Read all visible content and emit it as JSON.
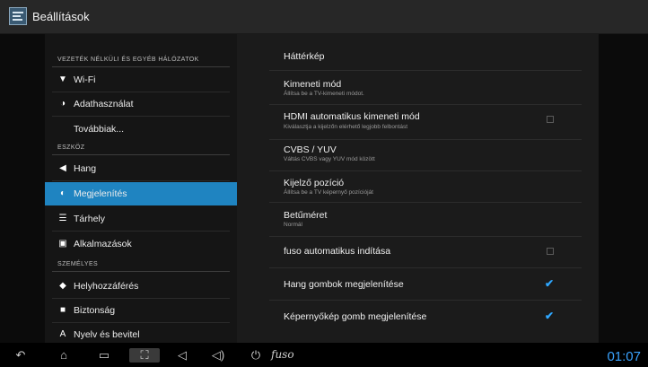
{
  "app": {
    "title": "Beállítások"
  },
  "sidebar": {
    "categories": [
      "VEZETÉK NÉLKÜLI ÉS EGYÉB HÁLÓZATOK",
      "ESZKÖZ",
      "SZEMÉLYES"
    ],
    "items": [
      {
        "label": "Wi-Fi",
        "icon": "wifi-icon"
      },
      {
        "label": "Adathasználat",
        "icon": "data-usage-icon"
      },
      {
        "label": "Továbbiak..."
      },
      {
        "label": "Hang",
        "icon": "speaker-icon"
      },
      {
        "label": "Megjelenítés",
        "icon": "display-icon"
      },
      {
        "label": "Tárhely",
        "icon": "storage-icon"
      },
      {
        "label": "Alkalmazások",
        "icon": "apps-icon"
      },
      {
        "label": "Helyhozzáférés",
        "icon": "location-icon"
      },
      {
        "label": "Biztonság",
        "icon": "lock-icon"
      },
      {
        "label": "Nyelv és bevitel",
        "icon": "language-icon"
      }
    ]
  },
  "settings": [
    {
      "title": "Háttérkép"
    },
    {
      "title": "Kimeneti mód",
      "subtitle": "Állítsa be a TV-kimeneti módot."
    },
    {
      "title": "HDMI automatikus kimeneti mód",
      "subtitle": "Kiválasztja a kijelzőn elérhető legjobb felbontást",
      "checked": false
    },
    {
      "title": "CVBS / YUV",
      "subtitle": "Váltás CVBS vagy YUV mód között"
    },
    {
      "title": "Kijelző pozíció",
      "subtitle": "Állítsa be a TV képernyő pozícióját"
    },
    {
      "title": "Betűméret",
      "subtitle": "Normál"
    },
    {
      "title": "fuso automatikus indítása",
      "checked": false
    },
    {
      "title": "Hang gombok megjelenítése",
      "checked": true
    },
    {
      "title": "Képernyőkép gomb megjelenítése",
      "checked": true
    }
  ],
  "navbar": {
    "brand": "fuso",
    "clock": "01:07"
  },
  "colors": {
    "accent": "#1f84c1",
    "clock": "#3aa3ff"
  }
}
